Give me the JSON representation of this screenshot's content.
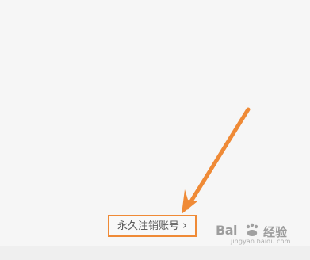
{
  "account": {
    "deactivate_label": "永久注销账号",
    "chevron": "›"
  },
  "watermark": {
    "brand": "Bai",
    "brand_suffix": "经验",
    "url": "jingyan.baidu.com"
  },
  "colors": {
    "background": "#f6f6f6",
    "highlight": "#ef8a36",
    "text": "#5b5b5b"
  },
  "icons": {
    "arrow": "orange-arrow-icon",
    "chevron": "chevron-right-icon",
    "watermark": "baidu-paw-icon"
  }
}
